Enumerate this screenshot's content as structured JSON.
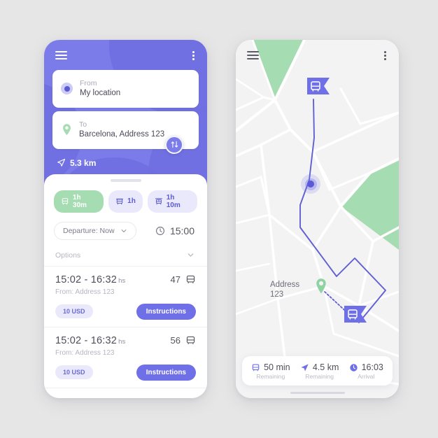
{
  "app": {
    "accent_purple": "#7b7bea",
    "accent_green": "#a6dcb2",
    "chip_bg": "#e9e9fb"
  },
  "left_phone": {
    "header": {
      "menu_icon": "hamburger-icon",
      "more_icon": "kebab-menu-icon",
      "from": {
        "label": "From",
        "value": "My location",
        "icon": "current-location-dot-icon"
      },
      "to": {
        "label": "To",
        "value": "Barcelona, Address 123",
        "icon": "map-pin-icon"
      },
      "swap_icon": "swap-arrows-icon",
      "distance_icon": "navigation-arrow-icon",
      "distance": "5.3 km"
    },
    "sheet": {
      "chips": [
        {
          "label": "1h 30m",
          "icon": "bus-icon",
          "active": true
        },
        {
          "label": "1h",
          "icon": "tram-icon",
          "active": false
        },
        {
          "label": "1h 10m",
          "icon": "train-icon",
          "active": false
        }
      ],
      "departure": {
        "label": "Departure: Now",
        "chevron_icon": "chevron-down-icon"
      },
      "clock_icon": "clock-icon",
      "time": "15:00",
      "options": {
        "label": "Options",
        "chevron_icon": "chevron-down-icon"
      },
      "routes": [
        {
          "time_range": "15:02 - 16:32",
          "time_unit": "hs",
          "line_number": "47",
          "vehicle_icon": "bus-icon",
          "from": "From: Address 123",
          "price": "10 USD",
          "action": "Instructions"
        },
        {
          "time_range": "15:02 - 16:32",
          "time_unit": "hs",
          "line_number": "56",
          "vehicle_icon": "bus-icon",
          "from": "From: Address 123",
          "price": "10 USD",
          "action": "Instructions"
        }
      ]
    }
  },
  "right_phone": {
    "menu_icon": "hamburger-icon",
    "more_icon": "kebab-menu-icon",
    "map": {
      "origin_marker_icon": "bus-flag-marker-icon",
      "current_position_icon": "current-location-dot-icon",
      "destination_marker_icon": "bus-flag-marker-icon",
      "destination_pin_icon": "map-pin-icon",
      "address_line1": "Address",
      "address_line2": "123",
      "road_color": "#ffffff",
      "park_color": "#a6dcb2",
      "route_color": "#6060d4"
    },
    "bottom_bar": [
      {
        "icon": "bus-icon",
        "value": "50 min",
        "sub": "Remaining"
      },
      {
        "icon": "navigation-arrow-icon",
        "value": "4.5 km",
        "sub": "Remaining"
      },
      {
        "icon": "clock-filled-icon",
        "value": "16:03",
        "sub": "Arrival"
      }
    ]
  }
}
